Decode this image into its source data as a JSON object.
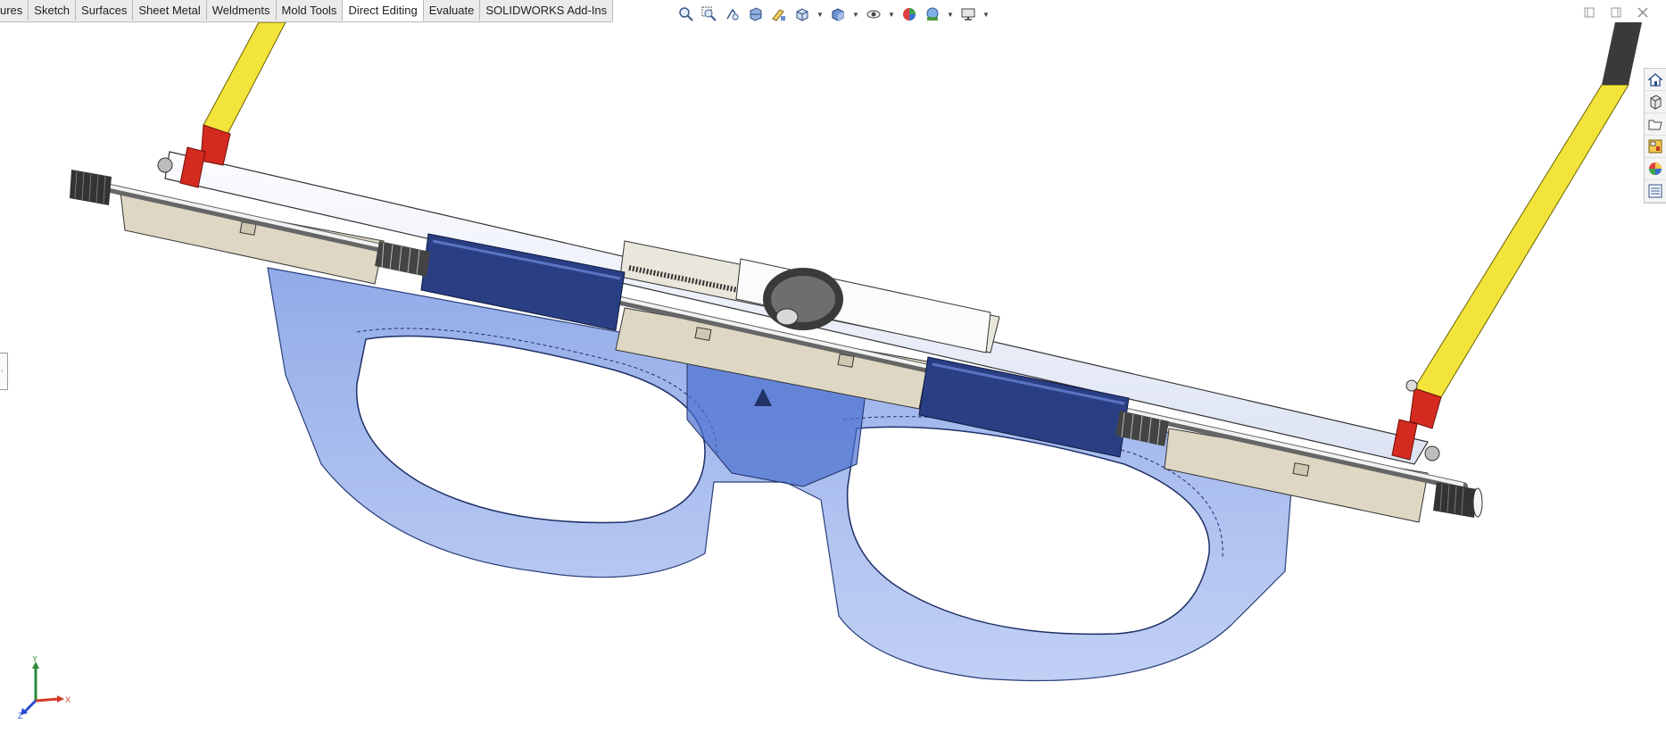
{
  "command_manager": {
    "tabs": [
      {
        "label": "ures",
        "active": false
      },
      {
        "label": "Sketch",
        "active": false
      },
      {
        "label": "Surfaces",
        "active": false
      },
      {
        "label": "Sheet Metal",
        "active": false
      },
      {
        "label": "Weldments",
        "active": false
      },
      {
        "label": "Mold Tools",
        "active": false
      },
      {
        "label": "Direct Editing",
        "active": true
      },
      {
        "label": "Evaluate",
        "active": false
      },
      {
        "label": "SOLIDWORKS Add-Ins",
        "active": false
      }
    ]
  },
  "heads_up_toolbar": {
    "icons": [
      "zoom-to-fit-icon",
      "zoom-to-area-icon",
      "previous-view-icon",
      "section-view-icon",
      "dynamic-annotation-icon",
      "view-orientation-icon",
      "display-style-icon",
      "hide-show-items-icon",
      "edit-appearance-icon",
      "apply-scene-icon",
      "view-settings-icon"
    ]
  },
  "task_pane": {
    "icons": [
      "solidworks-resources-icon",
      "design-library-icon",
      "file-explorer-icon",
      "view-palette-icon",
      "appearances-scenes-icon",
      "custom-properties-icon"
    ]
  },
  "triad": {
    "x_label": "X",
    "y_label": "Y",
    "z_label": "Z"
  },
  "colors": {
    "frame_blue": "#7f9fe6",
    "rod_yellow": "#f2e43a",
    "clip_red": "#d42a1f",
    "beige": "#ddd6c3",
    "sleeve_navy": "#24387a"
  }
}
